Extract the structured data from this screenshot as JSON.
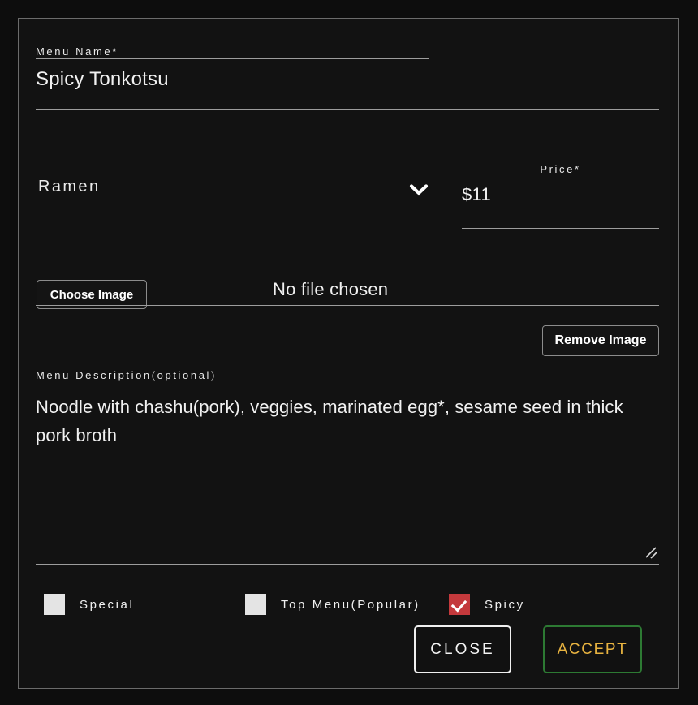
{
  "dialog": {
    "name_field": {
      "label": "Menu Name*",
      "value": "Spicy Tonkotsu"
    },
    "category_select": {
      "value": "Ramen",
      "icon": "chevron-down-icon"
    },
    "price_field": {
      "label": "Price*",
      "value": "$11"
    },
    "image_row": {
      "choose_label": "Choose Image",
      "file_status": "No file chosen",
      "remove_label": "Remove Image"
    },
    "description": {
      "label": "Menu Description(optional)",
      "value": "Noodle with chashu(pork), veggies, marinated egg*, sesame seed in thick pork broth"
    },
    "checkboxes": [
      {
        "label": "Special",
        "checked": false
      },
      {
        "label": "Top Menu(Popular)",
        "checked": false
      },
      {
        "label": "Spicy",
        "checked": true
      }
    ],
    "footer": {
      "close_label": "CLOSE",
      "accept_label": "ACCEPT"
    },
    "colors": {
      "background": "#0d0d0d",
      "panel": "#121212",
      "border": "#6b6b6b",
      "checked_red": "#c4393c",
      "accept_border_green": "#2d7a33",
      "accept_text_amber": "#e8b340"
    }
  }
}
